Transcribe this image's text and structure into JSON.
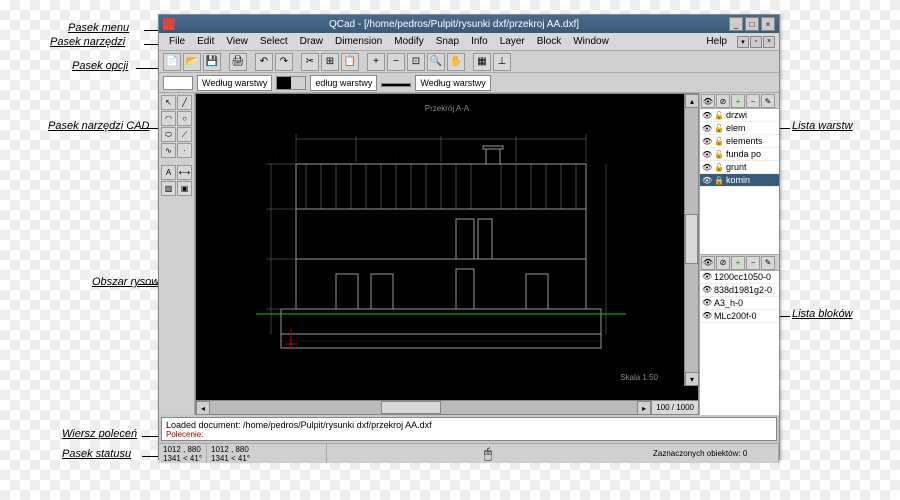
{
  "annotations": {
    "menu_bar": "Pasek menu",
    "toolbar": "Pasek narzędzi",
    "options_bar": "Pasek opcji",
    "cad_toolbar": "Pasek narzędzi CAD",
    "drawing_area": "Obszar rysowania",
    "command_line": "Wiersz poleceń",
    "status_bar": "Pasek statusu",
    "layer_list": "Lista warstw",
    "block_list": "Lista bloków"
  },
  "window": {
    "title": "QCad - [/home/pedros/Pulpit/rysunki dxf/przekroj AA.dxf]"
  },
  "menu": {
    "items": [
      "File",
      "Edit",
      "View",
      "Select",
      "Draw",
      "Dimension",
      "Modify",
      "Snap",
      "Info",
      "Layer",
      "Block",
      "Window"
    ],
    "help": "Help"
  },
  "options": {
    "label1": "Według warstwy",
    "label2": "edług warstwy",
    "label3": "Według warstwy"
  },
  "canvas": {
    "drawing_title": "Przekrój A-A",
    "scale": "Skala 1:50",
    "zoom": "100 / 1000"
  },
  "layers": {
    "items": [
      {
        "name": "drzwi",
        "visible": true,
        "locked": false,
        "selected": false
      },
      {
        "name": "elem",
        "visible": true,
        "locked": false,
        "selected": false
      },
      {
        "name": "elements",
        "visible": true,
        "locked": false,
        "selected": false
      },
      {
        "name": "funda po",
        "visible": true,
        "locked": false,
        "selected": false
      },
      {
        "name": "grunt",
        "visible": true,
        "locked": false,
        "selected": false
      },
      {
        "name": "komin",
        "visible": true,
        "locked": true,
        "selected": true
      }
    ]
  },
  "blocks": {
    "items": [
      {
        "name": "1200cc1050-0"
      },
      {
        "name": "838d1981g2-0"
      },
      {
        "name": "A3_h-0"
      },
      {
        "name": "MLc200f-0"
      }
    ]
  },
  "commandline": {
    "message": "Loaded document: /home/pedros/Pulpit/rysunki dxf/przekroj AA.dxf",
    "prompt": "Polecenie:"
  },
  "status": {
    "coords1a": "1012 , 880",
    "coords1b": "1341 < 41°",
    "coords2a": "1012 , 880",
    "coords2b": "1341 < 41°",
    "selected": "Zaznaczonych obiektów: 0"
  }
}
